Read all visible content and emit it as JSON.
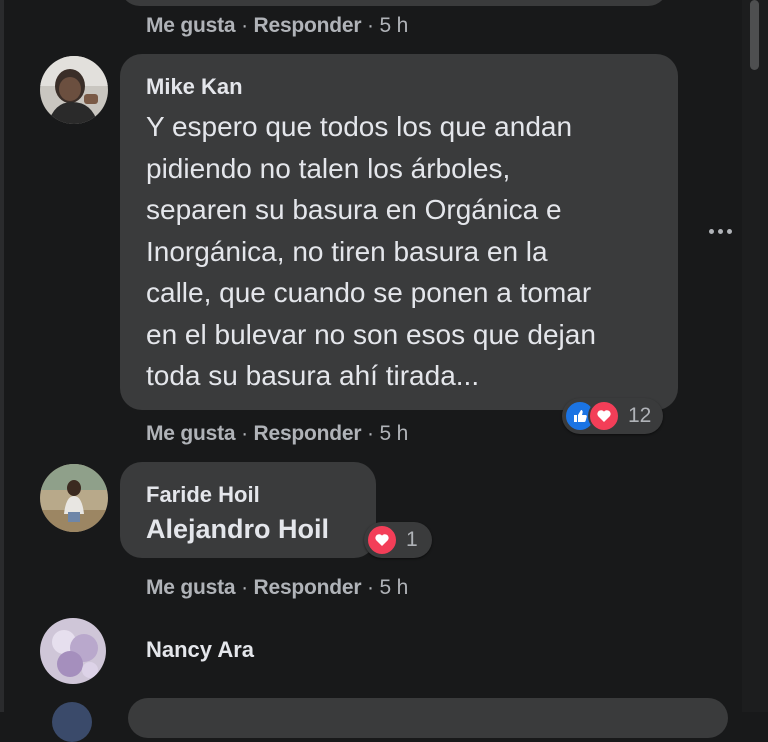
{
  "actions": {
    "like": "Me gusta",
    "reply": "Responder",
    "separator": "·"
  },
  "comments": [
    {
      "time": "5 h"
    },
    {
      "author": "Mike Kan",
      "lines": [
        "Y espero que todos los que andan",
        "pidiendo no talen los árboles,",
        "separen su basura en Orgánica e",
        "Inorgánica, no tiren basura en la",
        "calle, que cuando se ponen a tomar",
        "en el bulevar no son esos que dejan",
        "toda su basura ahí tirada..."
      ],
      "reactions": {
        "icons": [
          "like-icon",
          "love-icon"
        ],
        "count": "12"
      },
      "time": "5 h"
    },
    {
      "author": "Faride Hoil",
      "mention": "Alejandro Hoil",
      "reactions": {
        "icons": [
          "love-icon"
        ],
        "count": "1"
      },
      "time": "5 h"
    },
    {
      "author": "Nancy Ara"
    }
  ],
  "colors": {
    "background": "#18191a",
    "bubble": "#3a3b3c",
    "text": "#e4e6eb",
    "secondary": "#b0b3b8",
    "like": "#1b74e4",
    "love": "#f33e58"
  }
}
